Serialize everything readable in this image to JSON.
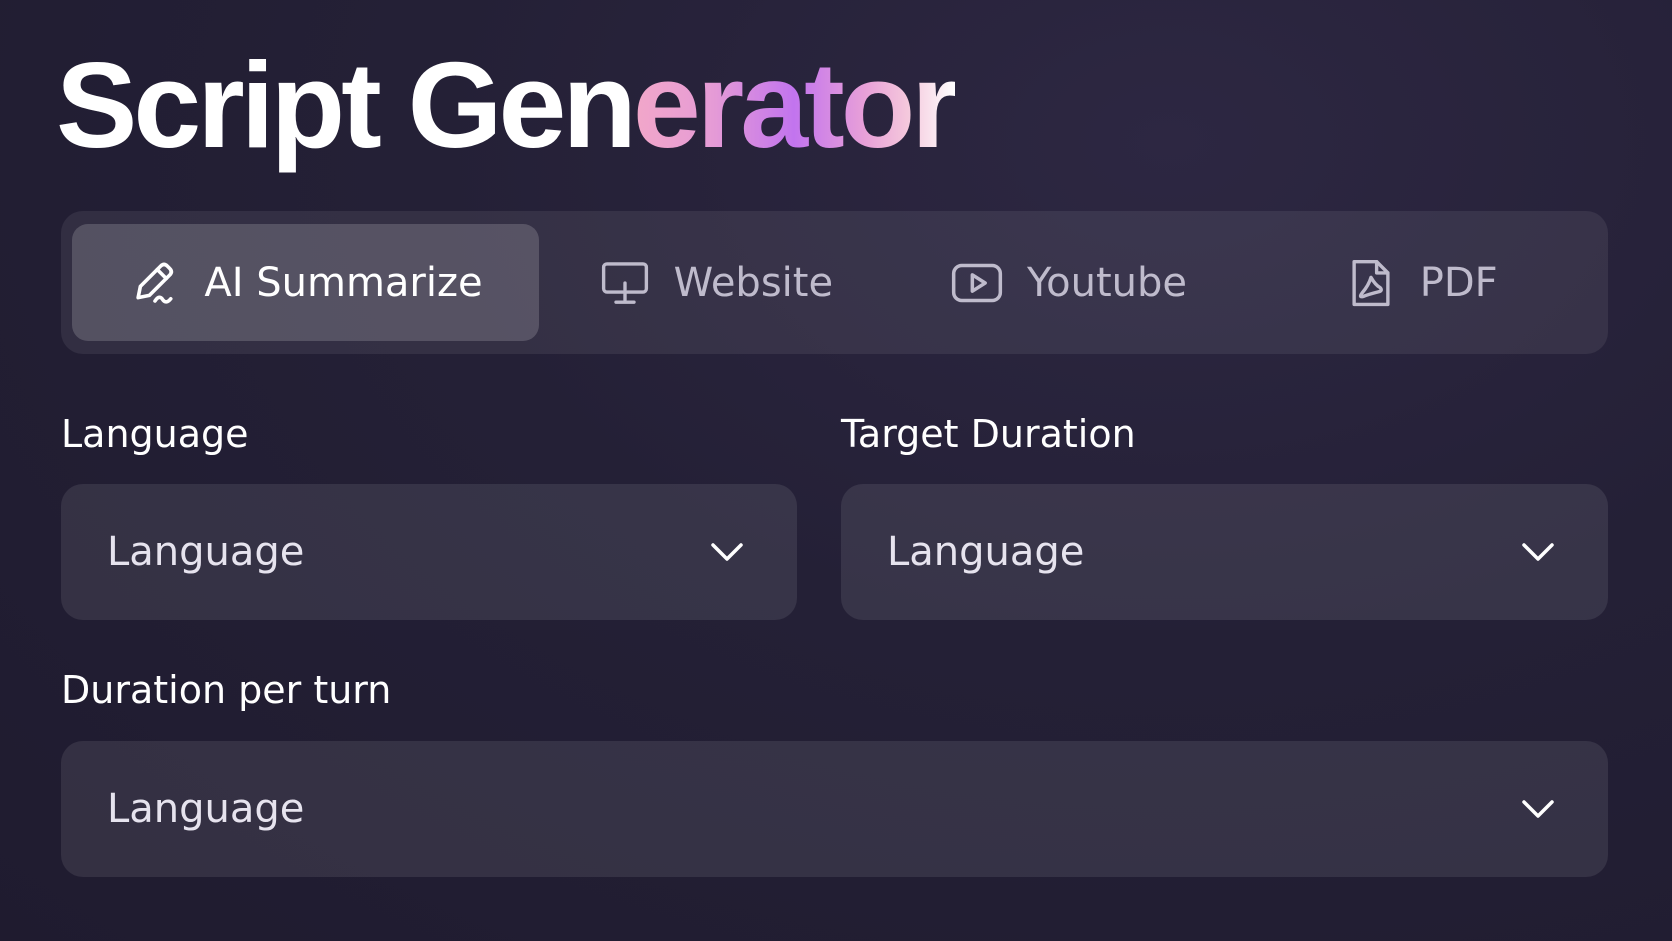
{
  "header": {
    "title_plain": "Script Gen",
    "title_accent": "erator"
  },
  "tabs": [
    {
      "label": "AI Summarize",
      "icon": "pen-icon",
      "active": true
    },
    {
      "label": "Website",
      "icon": "monitor-icon",
      "active": false
    },
    {
      "label": "Youtube",
      "icon": "play-icon",
      "active": false
    },
    {
      "label": "PDF",
      "icon": "pdf-icon",
      "active": false
    }
  ],
  "fields": {
    "language": {
      "label": "Language",
      "value": "Language"
    },
    "target_duration": {
      "label": "Target Duration",
      "value": "Language"
    },
    "duration_per_turn": {
      "label": "Duration per turn",
      "value": "Language"
    }
  },
  "colors": {
    "background": "#242036",
    "accent_gradient": [
      "#f2a7c9",
      "#c274ee",
      "#f4c7dc"
    ],
    "tab_active_bg": "#4a4558",
    "muted_text": "#bfbbcc"
  }
}
